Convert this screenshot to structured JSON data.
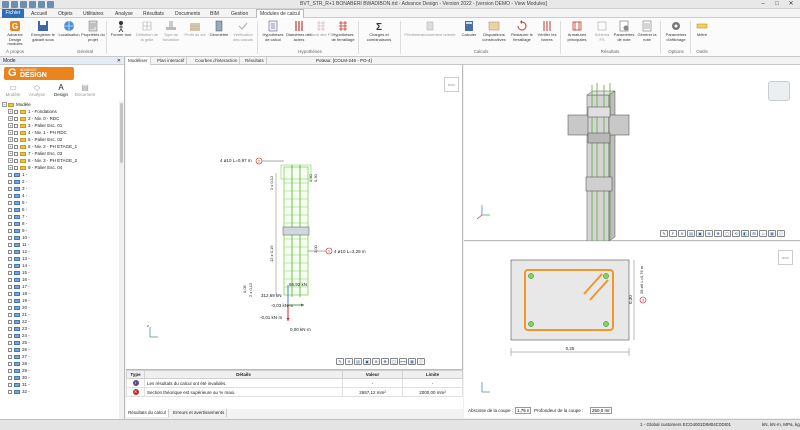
{
  "title_bar": {
    "title": "BVT_STR_R+1 BONABERI BWADIBON.rtd - Advance Design - Version 2022 - [version DEMO - View Modules]",
    "window_controls": [
      "–",
      "□",
      "✕"
    ]
  },
  "ribbon_tabs": {
    "file": "Fichier",
    "tabs": [
      "Accueil",
      "Objets",
      "Utilitaires",
      "Analyse",
      "Résultats",
      "Documents",
      "BIM",
      "Gestion",
      "Modules de calcul"
    ],
    "active": "Modules de calcul"
  },
  "ribbon": {
    "buttons": [
      {
        "label": "Advance Design modules",
        "icon": "advance-design-icon",
        "enabled": true
      },
      {
        "label": "Enregistrer le gabarit sous",
        "icon": "save-icon",
        "enabled": true
      },
      {
        "label": "Localisation",
        "icon": "globe-icon",
        "enabled": true
      },
      {
        "label": "Propriétés du projet",
        "icon": "properties-icon",
        "enabled": true
      },
      {
        "label": "Former tout",
        "icon": "person-icon",
        "enabled": true
      },
      {
        "label": "Définition de la grille",
        "icon": "grid-icon",
        "enabled": false
      },
      {
        "label": "Type de fondation",
        "icon": "foundation-icon",
        "enabled": false
      },
      {
        "label": "Profil du sol",
        "icon": "soil-icon",
        "enabled": false
      },
      {
        "label": "Géométrie",
        "icon": "geometry-icon",
        "enabled": true
      },
      {
        "label": "Vérification des calculs",
        "icon": "check-icon",
        "enabled": false
      },
      {
        "label": "Hypothèses de calcul",
        "icon": "hypothesis-icon",
        "enabled": true
      },
      {
        "label": "Diamètres des aciers",
        "icon": "bars-icon",
        "enabled": true
      },
      {
        "label": "Stock des FS",
        "icon": "stock-icon",
        "enabled": false
      },
      {
        "label": "Hypothèses de ferraillage",
        "icon": "rebar-grid-icon",
        "enabled": true
      },
      {
        "label": "Charges et combinaisons",
        "icon": "sigma-icon",
        "enabled": true
      },
      {
        "label": "Prédimensionnement orienté",
        "icon": "predim-icon",
        "enabled": false
      },
      {
        "label": "Calculer",
        "icon": "calculate-icon",
        "enabled": true
      },
      {
        "label": "Dispositions constructives",
        "icon": "constructive-icon",
        "enabled": true
      },
      {
        "label": "Restaurer le ferraillage",
        "icon": "restore-icon",
        "enabled": true
      },
      {
        "label": "Vérifier les barres",
        "icon": "verify-icon",
        "enabled": true
      },
      {
        "label": "Armatures principales",
        "icon": "rebar-icon",
        "enabled": true
      },
      {
        "label": "Schéma FS",
        "icon": "scheme-icon",
        "enabled": false
      },
      {
        "label": "Paramètres de note",
        "icon": "note-settings-icon",
        "enabled": true
      },
      {
        "label": "Générer la note",
        "icon": "note-icon",
        "enabled": true
      },
      {
        "label": "Paramètres d'affichage",
        "icon": "display-settings-icon",
        "enabled": true
      },
      {
        "label": "Métré",
        "icon": "measure-icon",
        "enabled": true
      }
    ],
    "groups": [
      "À propos",
      "Général",
      "Hypothèses",
      "Calculs",
      "Résultats",
      "Options",
      "Outils"
    ]
  },
  "left_panel": {
    "header": "Mode",
    "close": "✕",
    "logo_top": "ADVANCE",
    "logo_main": "DESIGN",
    "modes": [
      {
        "label": "Modèle",
        "icon": "model-icon"
      },
      {
        "label": "Analyse",
        "icon": "analysis-icon"
      },
      {
        "label": "Design",
        "icon": "design-icon"
      },
      {
        "label": "Document",
        "icon": "document-icon"
      }
    ],
    "active_mode": "Design",
    "tree_root": "Modèle",
    "tree_folders": [
      "1 - Fondations",
      "2 - Niv. 0 - RDC",
      "3 - Palier Esc. 01",
      "4 - Niv. 1 - PH RDC",
      "5 - Palier Esc. 02",
      "6 - Niv. 2 - PH ETAGE_1",
      "7 - Palier Esc. 03",
      "8 - Niv. 3 - PH ETAGE_2",
      "9 - Palier Esc. 04"
    ],
    "tree_levels": [
      "1 -",
      "2 -",
      "3 -",
      "4 -",
      "5 -",
      "6 -",
      "7 -",
      "8 -",
      "9 -",
      "10 -",
      "11 -",
      "12 -",
      "13 -",
      "14 -",
      "15 -",
      "16 -",
      "17 -",
      "18 -",
      "19 -",
      "20 -",
      "21 -",
      "22 -",
      "23 -",
      "24 -",
      "25 -",
      "26 -",
      "27 -",
      "28 -",
      "29 -",
      "30 -",
      "31 -",
      "32 -"
    ]
  },
  "view_tabs": {
    "tabs": [
      "Modéliser",
      "Plan interactif",
      "Courbes d'interaction",
      "Résultats"
    ],
    "active": "Modéliser",
    "element_title": "Poteau: [COLM-246 - PO-4]"
  },
  "elevation_view": {
    "label_top_rebar": "4 ø10 L=0,97 m",
    "label_main_rebar": "4 ø10 L=3,28 m",
    "marker_2": "2",
    "marker_1": "1",
    "dims": [
      "2 x 0,12",
      "12 x 0,19",
      "0,30",
      "0,30",
      "3,00",
      "0,05",
      "2 x 0,12"
    ],
    "force_1": "65,92 kN",
    "force_2": "312,69 kN",
    "moment_1": "-0,03 kN·m",
    "moment_2": "-0,01 kN·m",
    "moment_3": "0,00 kN·m"
  },
  "section_view": {
    "width_label": "0,25",
    "height_label": "0,30",
    "rebar_label": "28 ø6 L=0,76 m",
    "marker": "3"
  },
  "results_table": {
    "headers": [
      "Type",
      "Détails",
      "Valeur",
      "Limite"
    ],
    "rows": [
      {
        "type_icon": "info-icon",
        "color": "#5a4a9c",
        "details": "Les résultats du calcul ont été invalidés.",
        "value": "-",
        "limit": "-"
      },
      {
        "type_icon": "error-icon",
        "color": "#c62828",
        "details": "Section théorique est supérieure au % maxi.",
        "value": "2657,12 mm²",
        "limit": "2000,00 mm²"
      }
    ]
  },
  "result_tabs": {
    "tabs": [
      "Résultats du calcul",
      "Erreurs et avertissements"
    ],
    "active": "Résultats du calcul"
  },
  "section_controls": {
    "abscissa_label": "Abscisse de la coupe :",
    "abscissa_value": "1,75 m",
    "depth_label": "Profondeur de la coupe :",
    "depth_value": "250,0 mm"
  },
  "status_bar": {
    "left": "1 - Global customers ECO4001DIM04C0DI01",
    "right": "kN, kN·m, MPa, kg"
  },
  "colors": {
    "accent": "#2f6db5",
    "logo": "#e9851c",
    "rebar": "#f0962a",
    "concrete": "#7fd45a"
  }
}
